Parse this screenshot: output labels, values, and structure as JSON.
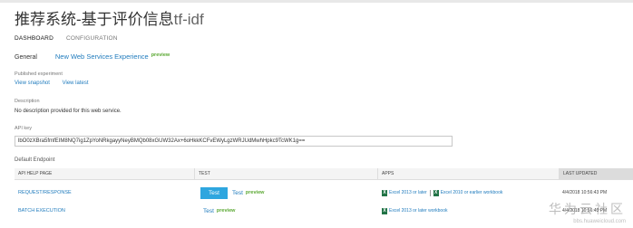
{
  "header": {
    "title": "推荐系统-基于评价信息",
    "title_suffix": "tf-idf"
  },
  "tabs": [
    {
      "label": "DASHBOARD",
      "active": true
    },
    {
      "label": "CONFIGURATION",
      "active": false
    }
  ],
  "general": {
    "label": "General",
    "experience_link": "New Web Services Experience",
    "preview": "preview"
  },
  "published_experiment": {
    "label": "Published experiment",
    "view_snapshot": "View snapshot",
    "view_latest": "View latest"
  },
  "description": {
    "label": "Description",
    "text": "No description provided for this web service."
  },
  "api_key": {
    "label": "API key",
    "value": "lbO0zXBra5fmfEIM8NQ7ig1ZpYoNRkgayyNeyBMQb08xGUW32Ax+6oHkkKCFvEWyLgzWRJUdMwhHpkc9TcWK1g=="
  },
  "endpoint": {
    "label": "Default Endpoint",
    "columns": {
      "api_help_page": "API HELP PAGE",
      "test": "TEST",
      "apps": "APPS",
      "last_updated": "LAST UPDATED"
    },
    "rows": [
      {
        "name": "REQUEST/RESPONSE",
        "test_button": "Test",
        "test_link": "Test",
        "preview": "preview",
        "app1": "Excel 2013 or later",
        "app2": "Excel 2010 or earlier workbook",
        "last_updated": "4/4/2018 10:56:43 PM"
      },
      {
        "name": "BATCH EXECUTION",
        "test_link": "Test",
        "preview": "preview",
        "app1": "Excel 2013 or later workbook",
        "last_updated": "4/4/2018 10:56:43 PM"
      }
    ]
  },
  "watermark": {
    "brand": "华为云社区",
    "url": "bbs.huaweicloud.com"
  },
  "colors": {
    "link": "#1f7bbd",
    "preview_green": "#5aa832",
    "test_button": "#2ea6df",
    "excel_green": "#217346",
    "header_bg": "#f4f4f4",
    "last_updated_header_bg": "#dcdcdc"
  },
  "icons": {
    "excel": "excel-icon"
  }
}
